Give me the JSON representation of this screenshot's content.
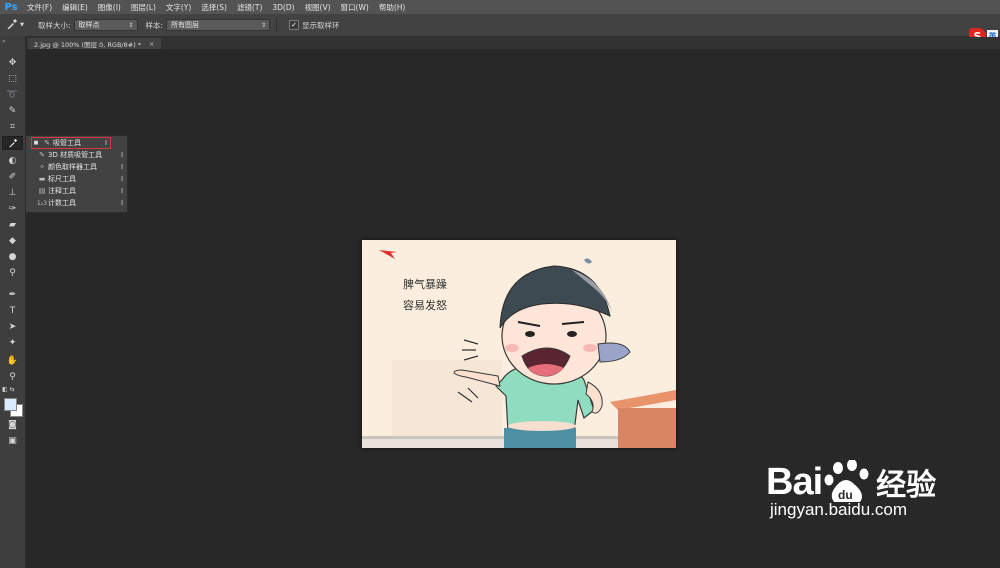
{
  "app": {
    "logo_text": "Ps"
  },
  "menubar": {
    "items": [
      {
        "label": "文件(F)"
      },
      {
        "label": "编辑(E)"
      },
      {
        "label": "图像(I)"
      },
      {
        "label": "图层(L)"
      },
      {
        "label": "文字(Y)"
      },
      {
        "label": "选择(S)"
      },
      {
        "label": "滤镜(T)"
      },
      {
        "label": "3D(D)"
      },
      {
        "label": "视图(V)"
      },
      {
        "label": "窗口(W)"
      },
      {
        "label": "帮助(H)"
      }
    ]
  },
  "options": {
    "tool_icon": "eyedropper-icon",
    "sample_size_label": "取样大小:",
    "sample_size_value": "取样点",
    "sample_label": "样本:",
    "sample_value": "所有图层",
    "show_ring_checked": true,
    "show_ring_label": "显示取样环"
  },
  "ime": {
    "logo": "S",
    "mode": "英"
  },
  "document": {
    "tab_title": "2.jpg @ 100% (图层 0, RGB/8#) *",
    "close_glyph": "×"
  },
  "flyout": {
    "items": [
      {
        "label": "吸管工具",
        "icon": "eyedropper-icon",
        "shortcut": "I",
        "selected": true
      },
      {
        "label": "3D 材质吸管工具",
        "icon": "3d-material-eyedropper-icon",
        "shortcut": "I",
        "selected": false
      },
      {
        "label": "颜色取样器工具",
        "icon": "color-sampler-icon",
        "shortcut": "I",
        "selected": false
      },
      {
        "label": "标尺工具",
        "icon": "ruler-icon",
        "shortcut": "I",
        "selected": false
      },
      {
        "label": "注释工具",
        "icon": "note-icon",
        "shortcut": "I",
        "selected": false
      },
      {
        "label": "计数工具",
        "icon": "count-icon",
        "shortcut": "I",
        "selected": false
      }
    ]
  },
  "canvas": {
    "line1": "脾气暴躁",
    "line2": "容易发怒"
  },
  "watermark": {
    "brand_text": "Bai",
    "brand_suffix": "经验",
    "url": "jingyan.baidu.com"
  },
  "colors": {
    "foreground": "#d9ecff",
    "background": "#ffffff",
    "highlight": "#d9363e"
  }
}
